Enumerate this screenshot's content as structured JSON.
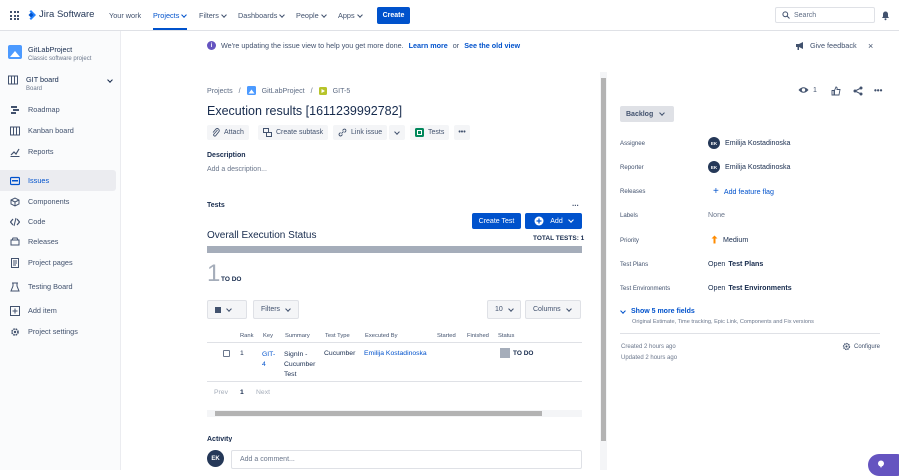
{
  "app": {
    "name": "Jira Software"
  },
  "topnav": {
    "items": [
      "Your work",
      "Projects",
      "Filters",
      "Dashboards",
      "People",
      "Apps"
    ],
    "create_label": "Create",
    "search_placeholder": "Search"
  },
  "sidebar": {
    "project_name": "GitLabProject",
    "project_type": "Classic software project",
    "board_name": "GIT board",
    "board_type": "Board",
    "items": [
      {
        "label": "Roadmap",
        "icon": "roadmap-icon"
      },
      {
        "label": "Kanban board",
        "icon": "board-icon"
      },
      {
        "label": "Reports",
        "icon": "reports-icon"
      },
      {
        "label": "Issues",
        "icon": "issues-icon"
      },
      {
        "label": "Components",
        "icon": "components-icon"
      },
      {
        "label": "Code",
        "icon": "code-icon"
      },
      {
        "label": "Releases",
        "icon": "releases-icon"
      },
      {
        "label": "Project pages",
        "icon": "pages-icon"
      },
      {
        "label": "Testing Board",
        "icon": "testing-board-icon"
      },
      {
        "label": "Add item",
        "icon": "add-item-icon"
      },
      {
        "label": "Project settings",
        "icon": "settings-icon"
      }
    ]
  },
  "banner": {
    "text": "We're updating the issue view to help you get more done.",
    "learn_more": "Learn more",
    "or": "or",
    "old_view": "See the old view",
    "feedback": "Give feedback"
  },
  "breadcrumb": {
    "root": "Projects",
    "project": "GitLabProject",
    "issue": "GIT-5"
  },
  "issue": {
    "title": "Execution results [1611239992782]",
    "actions": [
      "Attach",
      "Create subtask",
      "Link issue",
      "Tests"
    ],
    "description_label": "Description",
    "description_placeholder": "Add a description..."
  },
  "tests": {
    "section_label": "Tests",
    "more": "...",
    "create_test": "Create Test",
    "add": "Add",
    "overall_title": "Overall Execution Status",
    "total_tests": "TOTAL TESTS: 1",
    "todo_count": "1",
    "todo_label": "TO DO",
    "filters_label": "Filters",
    "page_size": "10",
    "columns_label": "Columns",
    "headers": [
      "Rank",
      "Key",
      "Summary",
      "Test Type",
      "Executed By",
      "Started",
      "Finished",
      "Status"
    ],
    "rows": [
      {
        "rank": "1",
        "key_a": "GIT-",
        "key_b": "4",
        "sum_a": "SignIn -",
        "sum_b": "Cucumber",
        "sum_c": "Test",
        "type": "Cucumber",
        "executed_by": "Emilija Kostadinoska",
        "status": "TO DO"
      }
    ],
    "pagination": {
      "prev": "Prev",
      "page": "1",
      "next": "Next"
    }
  },
  "activity": {
    "label": "Activity",
    "avatar": "EK",
    "comment_placeholder": "Add a comment..."
  },
  "right": {
    "watchers": "1",
    "status": "Backlog",
    "assignee_label": "Assignee",
    "assignee": "Emilija Kostadinoska",
    "reporter_label": "Reporter",
    "reporter": "Emilija Kostadinoska",
    "user_initials": "EK",
    "releases_label": "Releases",
    "add_feature_flag": "Add feature flag",
    "labels_label": "Labels",
    "labels_value": "None",
    "priority_label": "Priority",
    "priority_value": "Medium",
    "test_plans_label": "Test Plans",
    "test_plans_open": "Open",
    "test_plans_link": "Test Plans",
    "test_env_label": "Test Environments",
    "test_env_open": "Open",
    "test_env_link": "Test Environments",
    "show_more": "Show 5 more fields",
    "show_more_sub": "Original Estimate, Time tracking, Epic Link, Components and Fix versions",
    "created": "Created 2 hours ago",
    "updated": "Updated 2 hours ago",
    "configure": "Configure"
  },
  "colors": {
    "brand": "#0052cc",
    "status_todo": "#a5adba",
    "priority_medium": "#ff8b00"
  }
}
